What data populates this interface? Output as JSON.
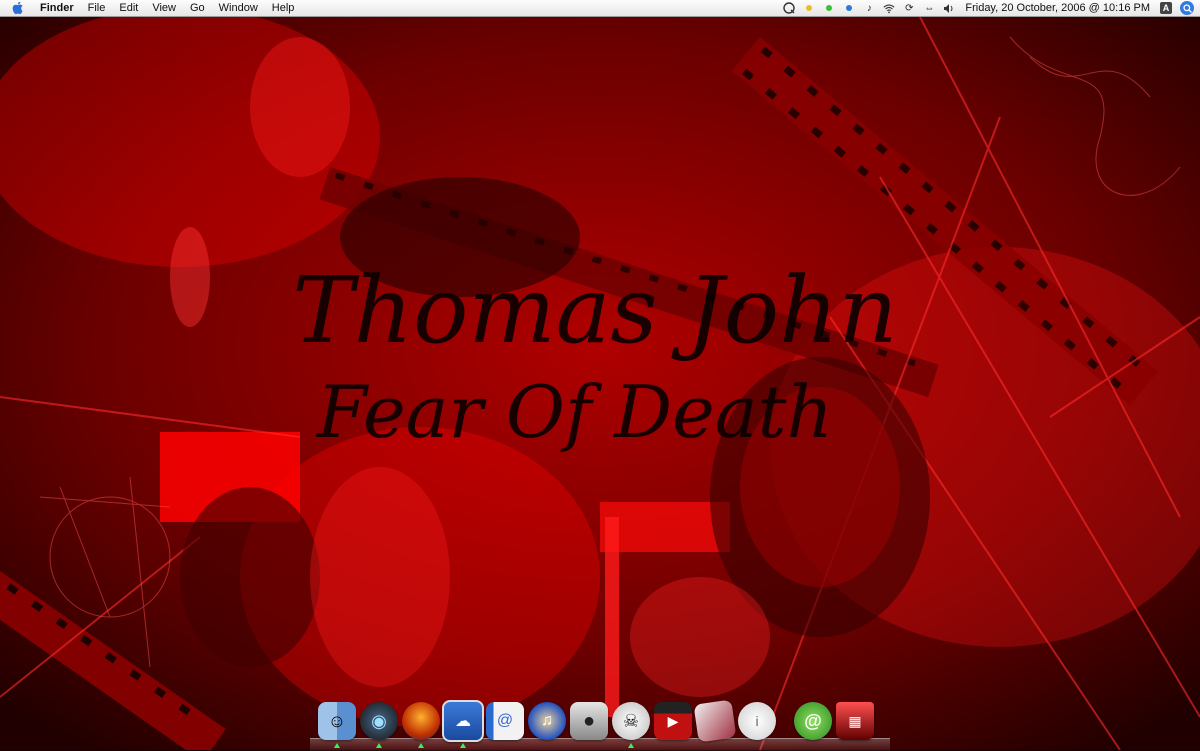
{
  "menubar": {
    "app_name": "Finder",
    "menus": [
      "File",
      "Edit",
      "View",
      "Go",
      "Window",
      "Help"
    ],
    "clock": "Friday, 20 October, 2006  @  10:16 PM",
    "status_icons": [
      "quicksilver-icon",
      "adium-status-icon",
      "green-status-icon",
      "blue-status-icon",
      "itunes-note-icon",
      "airport-wifi-icon",
      "sync-icon",
      "network-arrows-icon",
      "volume-icon",
      "user-icon",
      "spotlight-icon"
    ]
  },
  "wallpaper": {
    "title_line1": "Thomas John",
    "title_line2": "Fear Of Death"
  },
  "dock": {
    "items": [
      {
        "name": "finder",
        "running": true
      },
      {
        "name": "dashboard",
        "running": true
      },
      {
        "name": "firefox",
        "running": true
      },
      {
        "name": "preview",
        "running": true
      },
      {
        "name": "address-book",
        "running": false
      },
      {
        "name": "itunes",
        "running": false
      },
      {
        "name": "iphoto-camera",
        "running": false
      },
      {
        "name": "alien-app",
        "running": true
      },
      {
        "name": "imovie-clapper",
        "running": false
      },
      {
        "name": "photo-stack",
        "running": false
      },
      {
        "name": "ipod-updater",
        "running": false
      },
      {
        "name": "mail-at",
        "running": false
      },
      {
        "name": "trash",
        "running": false
      }
    ]
  },
  "colors": {
    "wallpaper_red": "#e00000",
    "wallpaper_dark": "#1a0000",
    "dock_running": "#3cf05a"
  }
}
